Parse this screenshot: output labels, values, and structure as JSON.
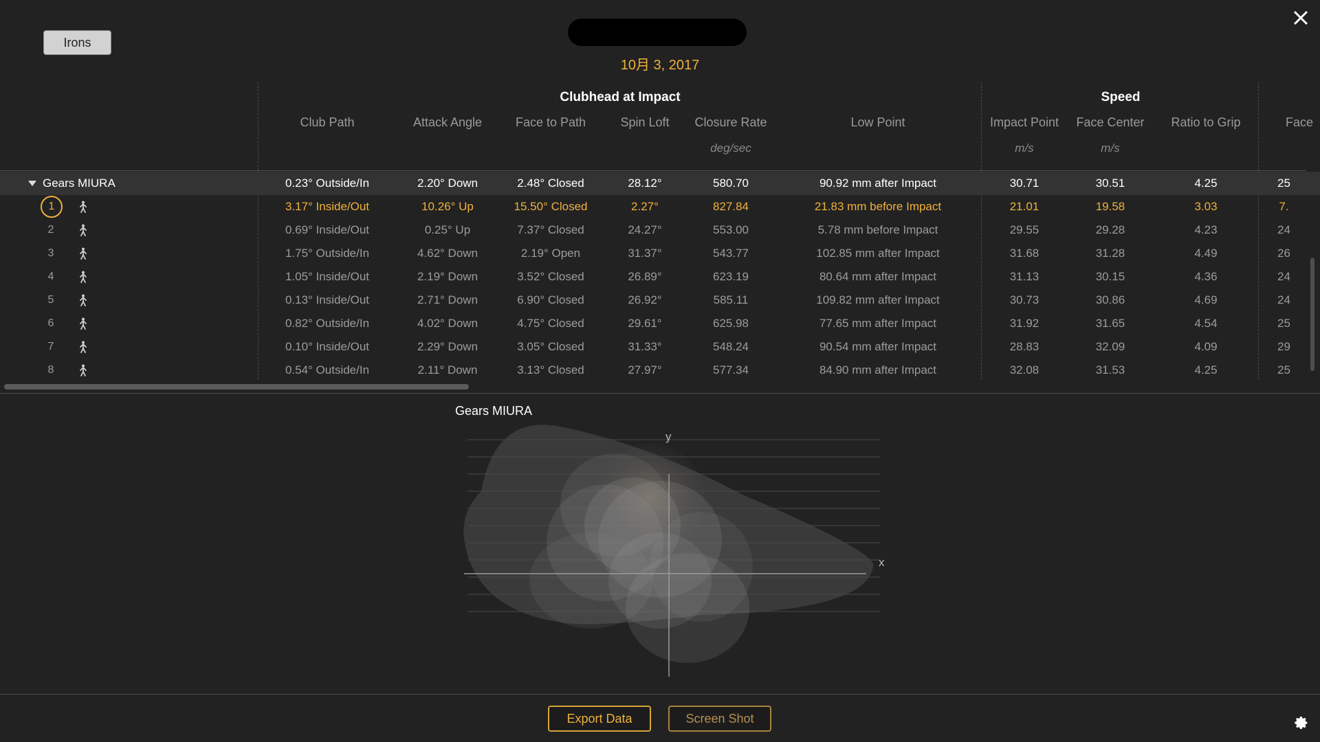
{
  "header": {
    "club_button": "Irons",
    "date": "10月 3, 2017"
  },
  "table": {
    "group1_title": "Clubhead at Impact",
    "group2_title": "Speed",
    "columns": [
      {
        "label": "Club Path",
        "unit": ""
      },
      {
        "label": "Attack Angle",
        "unit": ""
      },
      {
        "label": "Face to Path",
        "unit": ""
      },
      {
        "label": "Spin Loft",
        "unit": ""
      },
      {
        "label": "Closure Rate",
        "unit": "deg/sec"
      },
      {
        "label": "Low Point",
        "unit": ""
      },
      {
        "label": "Impact Point",
        "unit": "m/s"
      },
      {
        "label": "Face Center",
        "unit": "m/s"
      },
      {
        "label": "Ratio to Grip",
        "unit": ""
      },
      {
        "label": "Face ",
        "unit": ""
      }
    ],
    "summary": {
      "club": "Gears MIURA",
      "values": [
        "0.23° Outside/In",
        "2.20° Down",
        "2.48° Closed",
        "28.12°",
        "580.70",
        "90.92 mm after Impact",
        "30.71",
        "30.51",
        "4.25",
        "25"
      ]
    },
    "shots": [
      {
        "num": "1",
        "values": [
          "3.17° Inside/Out",
          "10.26° Up",
          "15.50° Closed",
          "2.27°",
          "827.84",
          "21.83 mm before Impact",
          "21.01",
          "19.58",
          "3.03",
          "7."
        ]
      },
      {
        "num": "2",
        "values": [
          "0.69° Inside/Out",
          "0.25° Up",
          "7.37° Closed",
          "24.27°",
          "553.00",
          "5.78 mm before Impact",
          "29.55",
          "29.28",
          "4.23",
          "24"
        ]
      },
      {
        "num": "3",
        "values": [
          "1.75° Outside/In",
          "4.62° Down",
          "2.19° Open",
          "31.37°",
          "543.77",
          "102.85 mm after Impact",
          "31.68",
          "31.28",
          "4.49",
          "26"
        ]
      },
      {
        "num": "4",
        "values": [
          "1.05° Inside/Out",
          "2.19° Down",
          "3.52° Closed",
          "26.89°",
          "623.19",
          "80.64 mm after Impact",
          "31.13",
          "30.15",
          "4.36",
          "24"
        ]
      },
      {
        "num": "5",
        "values": [
          "0.13° Inside/Out",
          "2.71° Down",
          "6.90° Closed",
          "26.92°",
          "585.11",
          "109.82 mm after Impact",
          "30.73",
          "30.86",
          "4.69",
          "24"
        ]
      },
      {
        "num": "6",
        "values": [
          "0.82° Outside/In",
          "4.02° Down",
          "4.75° Closed",
          "29.61°",
          "625.98",
          "77.65 mm after Impact",
          "31.92",
          "31.65",
          "4.54",
          "25"
        ]
      },
      {
        "num": "7",
        "values": [
          "0.10° Inside/Out",
          "2.29° Down",
          "3.05° Closed",
          "31.33°",
          "548.24",
          "90.54 mm after Impact",
          "28.83",
          "32.09",
          "4.09",
          "29"
        ]
      },
      {
        "num": "8",
        "values": [
          "0.54° Outside/In",
          "2.11° Down",
          "3.13° Closed",
          "27.97°",
          "577.34",
          "84.90 mm after Impact",
          "32.08",
          "31.53",
          "4.25",
          "25"
        ]
      }
    ]
  },
  "chart": {
    "title": "Gears MIURA",
    "x_label": "x",
    "y_label": "y"
  },
  "footer": {
    "export_label": "Export Data",
    "screenshot_label": "Screen Shot"
  },
  "colors": {
    "accent": "#f0b13c",
    "background": "#222222"
  }
}
